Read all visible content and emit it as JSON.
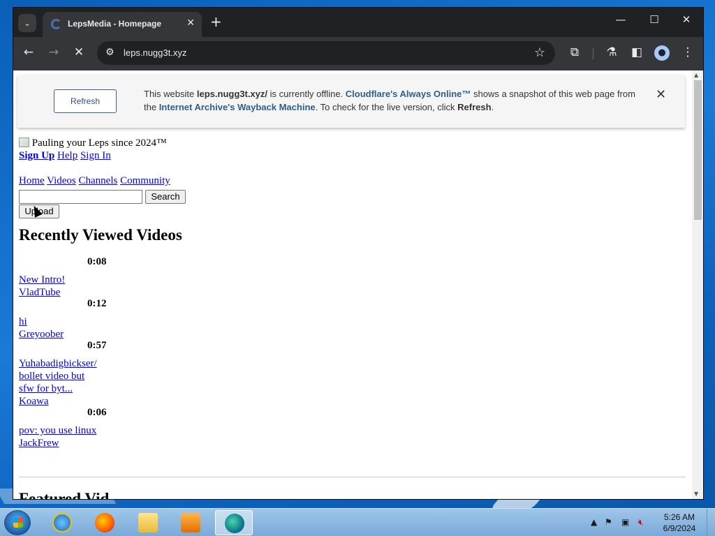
{
  "browser": {
    "tab_title": "LepsMedia - Homepage",
    "tab_close_icon": "close-icon",
    "new_tab_icon": "plus-icon",
    "url": "leps.nugg3t.xyz"
  },
  "banner": {
    "refresh_label": "Refresh",
    "msg_part1": "This website ",
    "msg_site": "leps.nugg3t.xyz/",
    "msg_part2": " is currently offline. ",
    "msg_cf": "Cloudflare's Always Online™",
    "msg_part3": " shows a snapshot of this web page from the ",
    "msg_archive": "Internet Archive's Wayback Machine",
    "msg_part4": ". To check for the live version, click ",
    "msg_refresh_word": "Refresh",
    "msg_end": "."
  },
  "page": {
    "tagline": "Pauling your Leps since 2024™",
    "account_links": [
      "Sign Up",
      "Help",
      "Sign In"
    ],
    "nav_links": [
      "Home",
      "Videos",
      "Channels",
      "Community"
    ],
    "search_value": "",
    "search_button": "Search",
    "upload_button": "Upload",
    "recent_heading": "Recently Viewed Videos",
    "videos": [
      {
        "duration": "0:08",
        "title": "New Intro!",
        "channel": "VladTube"
      },
      {
        "duration": "0:12",
        "title": "hi",
        "channel": "Greyoober"
      },
      {
        "duration": "0:57",
        "title_lines": [
          "Yuhabadigbickser/",
          "bollet video but",
          "sfw for byt..."
        ],
        "channel": "Koawa"
      },
      {
        "duration": "0:06",
        "title": "pov: you use linux",
        "channel": "JackFrew"
      }
    ],
    "featured_heading_partial": "Featured Vid"
  },
  "taskbar": {
    "clock_time": "5:26 AM",
    "clock_date": "6/9/2024"
  },
  "colors": {
    "link": "#0000ee",
    "cf_link": "#2f5d8c",
    "chrome_dark": "#202124"
  }
}
